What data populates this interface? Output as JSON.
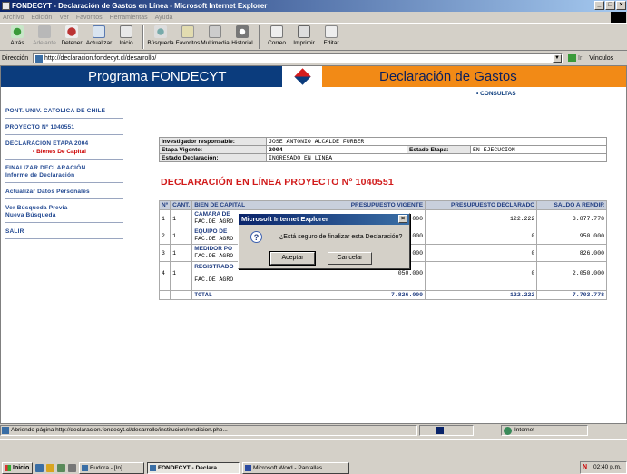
{
  "window": {
    "title": "FONDECYT - Declaración de Gastos en Línea - Microsoft Internet Explorer",
    "controls": [
      "_",
      "□",
      "×"
    ]
  },
  "menu": [
    "Archivo",
    "Edición",
    "Ver",
    "Favoritos",
    "Herramientas",
    "Ayuda"
  ],
  "toolbar": [
    {
      "label": "Atrás",
      "icon": "back-icon",
      "disabled": false
    },
    {
      "label": "Adelante",
      "icon": "forward-icon",
      "disabled": true
    },
    {
      "label": "Detener",
      "icon": "stop-icon",
      "disabled": false
    },
    {
      "label": "Actualizar",
      "icon": "refresh-icon",
      "disabled": false
    },
    {
      "label": "Inicio",
      "icon": "home-icon",
      "disabled": false
    },
    {
      "label": "Búsqueda",
      "icon": "search-icon",
      "disabled": false
    },
    {
      "label": "Favoritos",
      "icon": "favorites-icon",
      "disabled": false
    },
    {
      "label": "Multimedia",
      "icon": "media-icon",
      "disabled": false
    },
    {
      "label": "Historial",
      "icon": "history-icon",
      "disabled": false
    },
    {
      "label": "Correo",
      "icon": "mail-icon",
      "disabled": false
    },
    {
      "label": "Imprimir",
      "icon": "print-icon",
      "disabled": false
    },
    {
      "label": "Editar",
      "icon": "edit-icon",
      "disabled": false
    }
  ],
  "address": {
    "label": "Dirección",
    "url": "http://declaracion.fondecyt.cl/desarrollo/",
    "go": "Ir",
    "links": "Vínculos"
  },
  "banner": {
    "left": "Programa FONDECYT",
    "right": "Declaración de Gastos",
    "consultas": "• CONSULTAS"
  },
  "sidebar": {
    "institution": "PONT. UNIV. CATOLICA DE CHILE",
    "proyecto": "PROYECTO Nº 1040551",
    "etapa": "DECLARACIÓN ETAPA 2004",
    "etapa_sub": "• Bienes De Capital",
    "finalizar_1": "FINALIZAR DECLARACIÓN",
    "finalizar_2": "Informe de Declaración",
    "actualizar": "Actualizar Datos Personales",
    "busqueda_1": "Ver Búsqueda Previa",
    "busqueda_2": "Nueva Búsqueda",
    "salir": "SALIR"
  },
  "info": {
    "investigador_label": "Investigador responsable:",
    "investigador": "JOSE ANTONIO ALCALDE FURBER",
    "etapa_label": "Etapa Vigente:",
    "etapa": "2004",
    "estado_etapa_label": "Estado Etapa:",
    "estado_etapa": "EN EJECUCION",
    "estado_decl_label": "Estado Declaración:",
    "estado_decl": "INGRESADO EN LINEA"
  },
  "declaration_title": "DECLARACIÓN EN LÍNEA PROYECTO Nº 1040551",
  "capital_table": {
    "headers": [
      "Nº",
      "CANT.",
      "BIEN DE CAPITAL",
      "PRESUPUESTO VIGENTE",
      "PRESUPUESTO DECLARADO",
      "SALDO A RENDIR"
    ],
    "rows": [
      {
        "n": "1",
        "cant": "1",
        "name": "CAMARA DE",
        "sub": "FAC.DE AGRO",
        "vigente": "000.000",
        "declarado": "122.222",
        "saldo": "3.877.778"
      },
      {
        "n": "2",
        "cant": "1",
        "name": "EQUIPO DE",
        "sub": "FAC.DE AGRO",
        "vigente": "950.000",
        "declarado": "0",
        "saldo": "950.000"
      },
      {
        "n": "3",
        "cant": "1",
        "name": "MEDIDOR PO",
        "sub": "FAC.DE AGRO",
        "vigente": "826.000",
        "declarado": "0",
        "saldo": "826.000"
      },
      {
        "n": "4",
        "cant": "1",
        "name": "REGISTRADO",
        "sub": "FAC.DE AGRO",
        "vigente": "050.000",
        "declarado": "0",
        "saldo": "2.050.000"
      }
    ],
    "total_label": "TOTAL",
    "total_vigente": "7.826.000",
    "total_declarado": "122.222",
    "total_saldo": "7.703.778"
  },
  "dialog": {
    "title": "Microsoft Internet Explorer",
    "message": "¿Está seguro de finalizar esta Declaración?",
    "ok": "Aceptar",
    "cancel": "Cancelar"
  },
  "status": {
    "text": "Abriendo página http://declaracion.fondecyt.cl/desarrollo/institucion/rendicion.php...",
    "zone": "Internet",
    "progress": 0.2
  },
  "taskbar": {
    "start": "Inicio",
    "tasks": [
      {
        "label": "Eudora - [In]",
        "active": false
      },
      {
        "label": "FONDECYT - Declara...",
        "active": true
      },
      {
        "label": "Microsoft Word - Pantallas...",
        "active": false
      }
    ],
    "clock": "02:40 p.m."
  }
}
